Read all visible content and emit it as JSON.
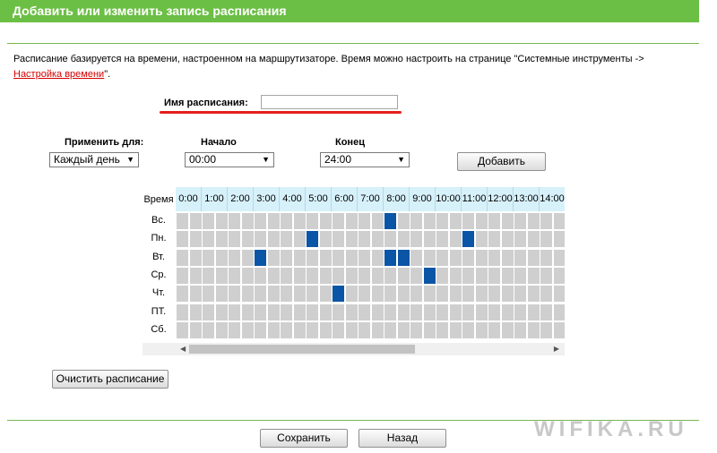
{
  "header": {
    "title": "Добавить или изменить запись расписания"
  },
  "description": {
    "text": "Расписание базируется на времени, настроенном на маршрутизаторе. Время можно настроить на странице \"Системные инструменты ->",
    "link": "Настройка времени",
    "tail": "\"."
  },
  "schedule_name": {
    "label": "Имя расписания:",
    "value": ""
  },
  "apply_for": {
    "label": "Применить для:",
    "value": "Каждый день"
  },
  "start": {
    "label": "Начало",
    "value": "00:00"
  },
  "end": {
    "label": "Конец",
    "value": "24:00"
  },
  "add_button": "Добавить",
  "grid": {
    "corner": "Время",
    "hours": [
      "0:00",
      "1:00",
      "2:00",
      "3:00",
      "4:00",
      "5:00",
      "6:00",
      "7:00",
      "8:00",
      "9:00",
      "10:00",
      "11:00",
      "12:00",
      "13:00",
      "14:00"
    ],
    "days": [
      "Вс.",
      "Пн.",
      "Вт.",
      "Ср.",
      "Чт.",
      "ПТ.",
      "Сб."
    ],
    "selected": [
      {
        "day": 0,
        "slot": 16
      },
      {
        "day": 1,
        "slot": 10
      },
      {
        "day": 1,
        "slot": 22
      },
      {
        "day": 2,
        "slot": 6
      },
      {
        "day": 2,
        "slot": 16
      },
      {
        "day": 2,
        "slot": 17
      },
      {
        "day": 3,
        "slot": 19
      },
      {
        "day": 4,
        "slot": 12
      }
    ]
  },
  "clear_button": "Очистить расписание",
  "save_button": "Сохранить",
  "back_button": "Назад",
  "watermark": "WIFIKA.RU",
  "colors": {
    "header": "#6cbf45",
    "selected_cell": "#0a55a5",
    "cell": "#cfcfcf",
    "hour_header": "#d7f1fb",
    "highlight": "#e41e1e"
  }
}
